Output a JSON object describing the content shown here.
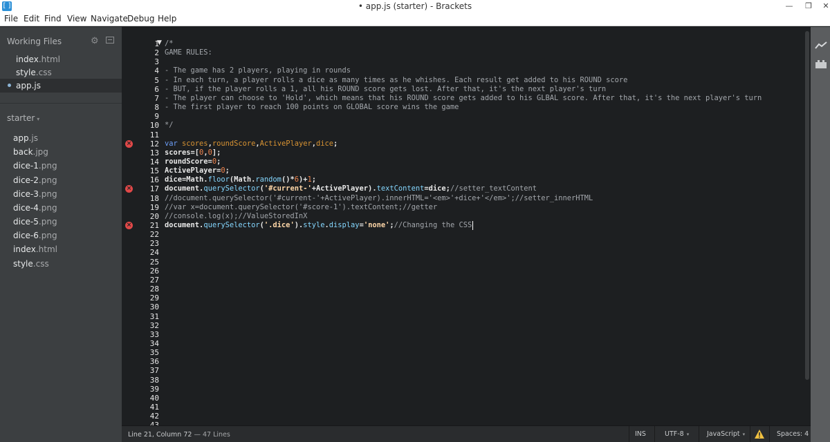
{
  "window": {
    "title": "• app.js (starter) - Brackets",
    "app_icon": "brackets-logo-icon",
    "controls": {
      "minimize": "—",
      "maximize": "❐",
      "close": "✕"
    }
  },
  "menu": [
    "File",
    "Edit",
    "Find",
    "View",
    "Navigate",
    "Debug",
    "Help"
  ],
  "sidebar": {
    "working_files_label": "Working Files",
    "working_files": [
      {
        "name": "index",
        "ext": ".html",
        "selected": false
      },
      {
        "name": "style",
        "ext": ".css",
        "selected": false
      },
      {
        "name": "app",
        "ext": ".js",
        "selected": true,
        "dirty": true
      }
    ],
    "project_name": "starter",
    "project_caret": "▾",
    "tree": [
      {
        "name": "app",
        "ext": ".js"
      },
      {
        "name": "back",
        "ext": ".jpg"
      },
      {
        "name": "dice-1",
        "ext": ".png"
      },
      {
        "name": "dice-2",
        "ext": ".png"
      },
      {
        "name": "dice-3",
        "ext": ".png"
      },
      {
        "name": "dice-4",
        "ext": ".png"
      },
      {
        "name": "dice-5",
        "ext": ".png"
      },
      {
        "name": "dice-6",
        "ext": ".png"
      },
      {
        "name": "index",
        "ext": ".html"
      },
      {
        "name": "style",
        "ext": ".css"
      }
    ]
  },
  "editor": {
    "visible_line_numbers": [
      "1",
      "2",
      "3",
      "4",
      "5",
      "6",
      "7",
      "8",
      "9",
      "10",
      "11",
      "12",
      "13",
      "14",
      "15",
      "16",
      "17",
      "18",
      "19",
      "20",
      "21",
      "22",
      "23",
      "24",
      "25",
      "26",
      "27",
      "28",
      "29",
      "30",
      "31",
      "32",
      "33",
      "34",
      "35",
      "36",
      "37",
      "38",
      "39",
      "40",
      "41",
      "42",
      "43"
    ],
    "error_lines": [
      12,
      17,
      21
    ],
    "fold_arrow": "▼",
    "lines": [
      [
        [
          "comment",
          "/*"
        ]
      ],
      [
        [
          "comment",
          "GAME RULES:"
        ]
      ],
      [],
      [
        [
          "comment",
          "- The game has 2 players, playing in rounds"
        ]
      ],
      [
        [
          "comment",
          "- In each turn, a player rolls a dice as many times as he whishes. Each result get added to his ROUND score"
        ]
      ],
      [
        [
          "comment",
          "- BUT, if the player rolls a 1, all his ROUND score gets lost. After that, it's the next player's turn"
        ]
      ],
      [
        [
          "comment",
          "- The player can choose to 'Hold', which means that his ROUND score gets added to his GLBAL score. After that, it's the next player's turn"
        ]
      ],
      [
        [
          "comment",
          "- The first player to reach 100 points on GLOBAL score wins the game"
        ]
      ],
      [],
      [
        [
          "comment",
          "*/"
        ]
      ],
      [],
      [
        [
          "keyword",
          "var "
        ],
        [
          "var",
          "scores"
        ],
        [
          "plain",
          ","
        ],
        [
          "var",
          "roundScore"
        ],
        [
          "plain",
          ","
        ],
        [
          "var",
          "ActivePlayer"
        ],
        [
          "plain",
          ","
        ],
        [
          "var",
          "dice"
        ],
        [
          "plain",
          ";"
        ]
      ],
      [
        [
          "plain",
          "scores=["
        ],
        [
          "number",
          "0"
        ],
        [
          "plain",
          ","
        ],
        [
          "number",
          "0"
        ],
        [
          "plain",
          "];"
        ]
      ],
      [
        [
          "plain",
          "roundScore="
        ],
        [
          "number",
          "0"
        ],
        [
          "plain",
          ";"
        ]
      ],
      [
        [
          "plain",
          "ActivePlayer="
        ],
        [
          "number",
          "0"
        ],
        [
          "plain",
          ";"
        ]
      ],
      [
        [
          "plain",
          "dice=Math."
        ],
        [
          "prop",
          "floor"
        ],
        [
          "plain",
          "(Math."
        ],
        [
          "prop",
          "random"
        ],
        [
          "plain",
          "()*"
        ],
        [
          "number",
          "6"
        ],
        [
          "plain",
          ")+"
        ],
        [
          "number",
          "1"
        ],
        [
          "plain",
          ";"
        ]
      ],
      [
        [
          "plain",
          "document."
        ],
        [
          "prop",
          "querySelector"
        ],
        [
          "plain",
          "("
        ],
        [
          "string",
          "'#current-'"
        ],
        [
          "plain",
          "+ActivePlayer)."
        ],
        [
          "prop",
          "textContent"
        ],
        [
          "plain",
          "=dice;"
        ],
        [
          "comment",
          "//setter_textContent"
        ]
      ],
      [
        [
          "comment",
          "//document.querySelector('#current-'+ActivePlayer).innerHTML='<em>'+dice+'</em>';//setter_innerHTML"
        ]
      ],
      [
        [
          "comment",
          "//var x=document.querySelector('#score-1').textContent;//getter"
        ]
      ],
      [
        [
          "comment",
          "//console.log(x);//ValueStoredInX"
        ]
      ],
      [
        [
          "plain",
          "document."
        ],
        [
          "prop",
          "querySelector"
        ],
        [
          "plain",
          "("
        ],
        [
          "string",
          "'.dice'"
        ],
        [
          "plain",
          ")."
        ],
        [
          "prop",
          "style"
        ],
        [
          "plain",
          "."
        ],
        [
          "prop",
          "display"
        ],
        [
          "plain",
          "="
        ],
        [
          "string",
          "'none'"
        ],
        [
          "plain",
          ";"
        ],
        [
          "comment",
          "//Changing the CSS"
        ]
      ]
    ]
  },
  "statusbar": {
    "cursor_position": "Line 21, Column 72",
    "line_count": " — 47 Lines",
    "insert_mode": "INS",
    "encoding": "UTF-8",
    "language": "JavaScript",
    "indent": "Spaces:",
    "indent_size": "4",
    "caret": "▾",
    "lint_status": "warning-icon"
  },
  "right_toolbar": {
    "icons": [
      "live-preview-icon",
      "extension-manager-icon"
    ]
  }
}
